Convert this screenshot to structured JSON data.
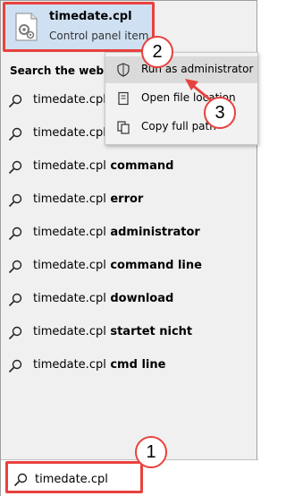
{
  "best_match": {
    "title": "timedate.cpl",
    "subtitle": "Control panel item",
    "icon": "control-panel-icon"
  },
  "search_web": {
    "header": "Search the web",
    "results": [
      {
        "base": "timedate.cpl",
        "suffix": ""
      },
      {
        "base": "timedate.cpl",
        "suffix": ""
      },
      {
        "base": "timedate.cpl",
        "suffix": " command"
      },
      {
        "base": "timedate.cpl",
        "suffix": " error"
      },
      {
        "base": "timedate.cpl",
        "suffix": " administrator"
      },
      {
        "base": "timedate.cpl",
        "suffix": " command line"
      },
      {
        "base": "timedate.cpl",
        "suffix": " download"
      },
      {
        "base": "timedate.cpl",
        "suffix": " startet nicht"
      },
      {
        "base": "timedate.cpl",
        "suffix": " cmd line"
      }
    ]
  },
  "context_menu": {
    "items": [
      {
        "label": "Run as administrator",
        "icon": "shield-icon"
      },
      {
        "label": "Open file location",
        "icon": "folder-icon"
      },
      {
        "label": "Copy full path",
        "icon": "copy-icon"
      }
    ]
  },
  "search": {
    "value": "timedate.cpl"
  },
  "callouts": {
    "one": "1",
    "two": "2",
    "three": "3"
  },
  "colors": {
    "accent": "#e8413e",
    "highlight": "#cfe0f2"
  }
}
